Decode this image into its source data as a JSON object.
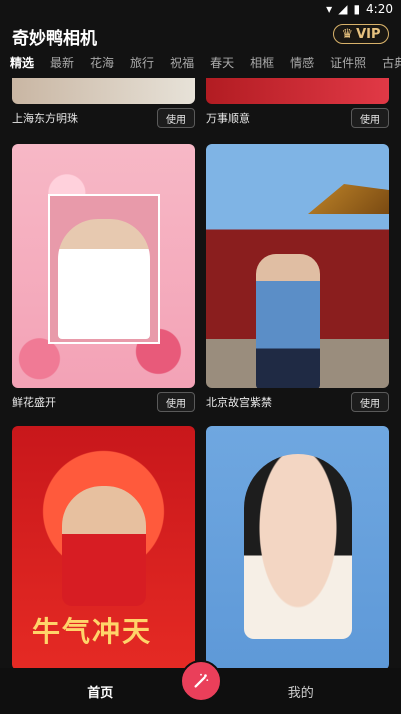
{
  "status": {
    "time": "4:20"
  },
  "header": {
    "title": "奇妙鸭相机",
    "vip": "VIP"
  },
  "tabs": [
    "精选",
    "最新",
    "花海",
    "旅行",
    "祝福",
    "春天",
    "相框",
    "情感",
    "证件照",
    "古典"
  ],
  "cards": [
    {
      "name": "上海东方明珠",
      "button": "使用"
    },
    {
      "name": "万事顺意",
      "button": "使用"
    },
    {
      "name": "鲜花盛开",
      "button": "使用"
    },
    {
      "name": "北京故宫紫禁",
      "button": "使用"
    },
    {
      "name": "",
      "button": "",
      "overlay_text": "牛气冲天"
    },
    {
      "name": "",
      "button": ""
    }
  ],
  "bottom_nav": {
    "home": "首页",
    "mine": "我的"
  },
  "colors": {
    "vip_gold": "#d8b26a",
    "fab": "#ea3f5a"
  }
}
